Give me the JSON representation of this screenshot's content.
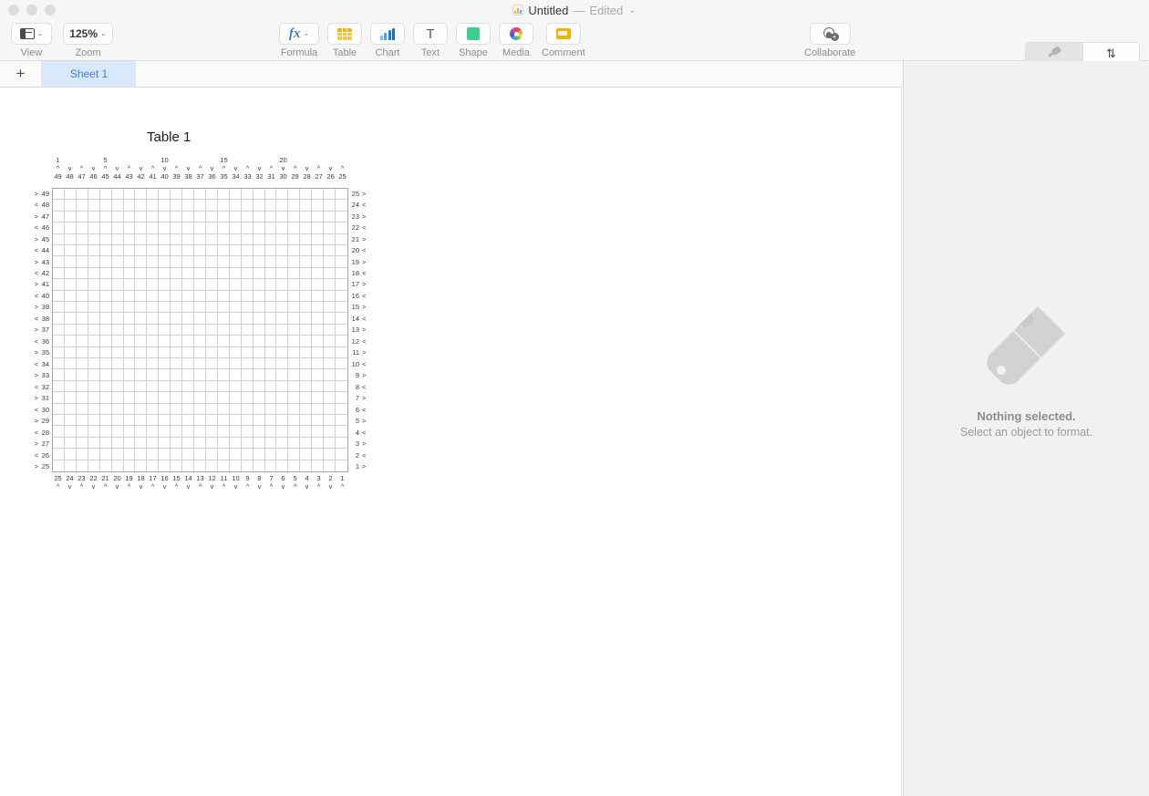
{
  "window": {
    "traffic_lights": [
      "close",
      "minimize",
      "zoom"
    ]
  },
  "titlebar": {
    "doc_title": "Untitled",
    "separator": "—",
    "edited_state": "Edited",
    "chevron": "⌄",
    "doc_icon": "numbers-document-icon"
  },
  "toolbar": {
    "left_items": [
      {
        "label": "View",
        "icon": "sidebar-view-icon",
        "has_chevron": true
      },
      {
        "label": "Zoom",
        "icon": "zoom-level",
        "value": "125%",
        "has_chevron": true
      }
    ],
    "center_items": [
      {
        "label": "Formula",
        "icon": "fx-icon",
        "value": "fx",
        "has_chevron": true
      },
      {
        "label": "Table",
        "icon": "table-icon",
        "has_chevron": false
      },
      {
        "label": "Chart",
        "icon": "chart-icon",
        "has_chevron": false
      },
      {
        "label": "Text",
        "icon": "text-t-icon",
        "value": "T",
        "has_chevron": false
      },
      {
        "label": "Shape",
        "icon": "shape-icon",
        "has_chevron": false
      },
      {
        "label": "Media",
        "icon": "media-icon",
        "has_chevron": false
      },
      {
        "label": "Comment",
        "icon": "comment-icon",
        "has_chevron": false
      }
    ],
    "collaborate": {
      "label": "Collaborate",
      "icon": "add-person-icon",
      "badge": "+"
    },
    "right_segment": [
      {
        "label": "Format",
        "icon": "paintbrush-icon",
        "active": true
      },
      {
        "label": "Sort & Filter",
        "icon": "sort-arrows-icon",
        "active": false
      }
    ]
  },
  "tabbar": {
    "add_sheet": "+",
    "add_sheet_icon": "plus-icon",
    "sheets": [
      {
        "label": "Sheet 1",
        "active": true
      }
    ]
  },
  "inspector": {
    "icon": "paintbrush-large-icon",
    "title": "Nothing selected.",
    "hint": "Select an object to format."
  },
  "table": {
    "title": "Table 1",
    "columns": 25,
    "rows": 25,
    "top_tick_labels": [
      {
        "col": 1,
        "text": "1"
      },
      {
        "col": 5,
        "text": "5"
      },
      {
        "col": 10,
        "text": "10"
      },
      {
        "col": 15,
        "text": "15"
      },
      {
        "col": 20,
        "text": "20"
      }
    ],
    "top_arrows": [
      "^",
      "v",
      "^",
      "v",
      "^",
      "v",
      "^",
      "v",
      "^",
      "v",
      "^",
      "v",
      "^",
      "v",
      "^",
      "v",
      "^",
      "v",
      "^",
      "v",
      "^",
      "v",
      "^",
      "v",
      "^"
    ],
    "top_numbers": [
      49,
      48,
      47,
      46,
      45,
      44,
      43,
      42,
      41,
      40,
      39,
      38,
      37,
      36,
      35,
      34,
      33,
      32,
      31,
      30,
      29,
      28,
      27,
      26,
      25
    ],
    "left_arrows": [
      ">",
      "<",
      ">",
      "<",
      ">",
      "<",
      ">",
      "<",
      ">",
      "<",
      ">",
      "<",
      ">",
      "<",
      ">",
      "<",
      ">",
      "<",
      ">",
      "<",
      ">",
      "<",
      ">",
      "<",
      ">"
    ],
    "left_numbers": [
      49,
      48,
      47,
      46,
      45,
      44,
      43,
      42,
      41,
      40,
      39,
      38,
      37,
      36,
      35,
      34,
      33,
      32,
      31,
      30,
      29,
      28,
      27,
      26,
      25
    ],
    "right_numbers": [
      25,
      24,
      23,
      22,
      21,
      20,
      19,
      18,
      17,
      16,
      15,
      14,
      13,
      12,
      11,
      10,
      9,
      8,
      7,
      6,
      5,
      4,
      3,
      2,
      1
    ],
    "right_arrows": [
      ">",
      "<",
      ">",
      "<",
      ">",
      "<",
      ">",
      "<",
      ">",
      "<",
      ">",
      "<",
      ">",
      "<",
      ">",
      "<",
      ">",
      "<",
      ">",
      "<",
      ">",
      "<",
      ">",
      "<",
      ">"
    ],
    "bottom_numbers": [
      25,
      24,
      23,
      22,
      21,
      20,
      19,
      18,
      17,
      16,
      15,
      14,
      13,
      12,
      11,
      10,
      9,
      8,
      7,
      6,
      5,
      4,
      3,
      2,
      1
    ],
    "bottom_arrows": [
      "^",
      "v",
      "^",
      "v",
      "^",
      "v",
      "^",
      "v",
      "^",
      "v",
      "^",
      "v",
      "^",
      "v",
      "^",
      "v",
      "^",
      "v",
      "^",
      "v",
      "^",
      "v",
      "^",
      "v",
      "^"
    ],
    "cells_empty": true
  },
  "colors": {
    "chrome_bg": "#f6f6f6",
    "tab_active_bg": "#d9e8fb",
    "tab_active_text": "#3a7fd5",
    "inspector_bg": "#f1f1f1",
    "grid_line": "#d2d2d2",
    "grid_border": "#a8a8a8",
    "label_text": "#3b3b3b",
    "toolbar_label": "#8d8d8d"
  }
}
